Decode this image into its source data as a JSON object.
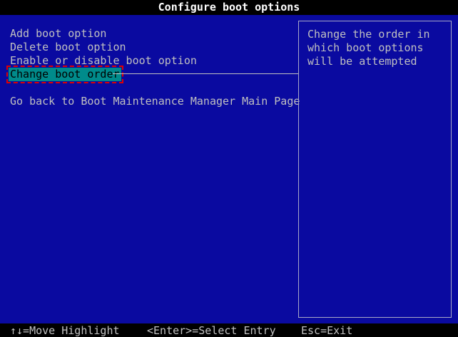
{
  "title": "Configure boot options",
  "menu": {
    "items": [
      {
        "label": "Add boot option"
      },
      {
        "label": "Delete boot option"
      },
      {
        "label": "Enable or disable boot option"
      },
      {
        "label": "Change boot order",
        "selected": true
      },
      {
        "label": "Go back to Boot Maintenance Manager Main Page"
      }
    ]
  },
  "help": {
    "text": "Change the order in\nwhich boot options\nwill be attempted"
  },
  "footer": {
    "move": "↑↓=Move Highlight",
    "select": "<Enter>=Select Entry",
    "exit": "Esc=Exit"
  },
  "colors": {
    "background": "#0a0aa0",
    "highlight": "#008b8b",
    "text": "#c0c0c0",
    "annotation": "#e00000"
  }
}
